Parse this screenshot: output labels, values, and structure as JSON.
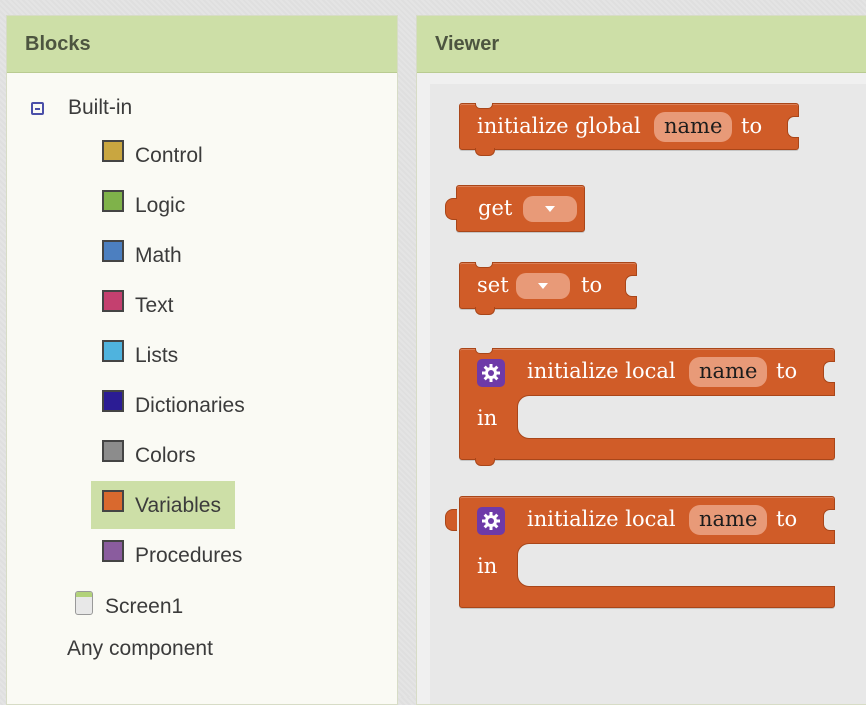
{
  "blocks_panel": {
    "title": "Blocks",
    "builtin_label": "Built-in",
    "categories": [
      {
        "label": "Control",
        "color": "#c9a640"
      },
      {
        "label": "Logic",
        "color": "#7fb24a"
      },
      {
        "label": "Math",
        "color": "#4c7fc0"
      },
      {
        "label": "Text",
        "color": "#c4406f"
      },
      {
        "label": "Lists",
        "color": "#4fb3de"
      },
      {
        "label": "Dictionaries",
        "color": "#2b1c94"
      },
      {
        "label": "Colors",
        "color": "#8c8c8c"
      },
      {
        "label": "Variables",
        "color": "#d9692e"
      },
      {
        "label": "Procedures",
        "color": "#8a5c9e"
      }
    ],
    "selected_category": "Variables",
    "screen_label": "Screen1",
    "any_component_label": "Any component"
  },
  "viewer": {
    "title": "Viewer",
    "blocks": {
      "init_global": {
        "text": "initialize global",
        "name": "name",
        "to": "to"
      },
      "get": {
        "text": "get"
      },
      "set": {
        "text": "set",
        "to": "to"
      },
      "init_local_1": {
        "text": "initialize local",
        "name": "name",
        "to": "to",
        "in": "in"
      },
      "init_local_2": {
        "text": "initialize local",
        "name": "name",
        "to": "to",
        "in": "in"
      }
    }
  },
  "colors": {
    "variable_block": "#d05c28",
    "header_green": "#cddfa7",
    "mutator_purple": "#6e3aa8"
  }
}
